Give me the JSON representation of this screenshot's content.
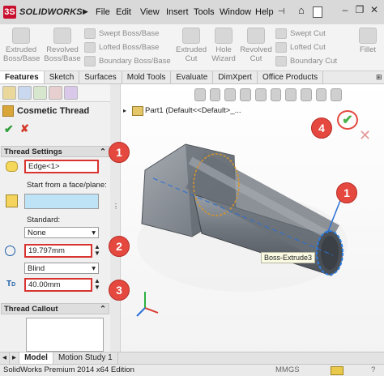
{
  "app": {
    "logo_text": "SOLIDWORKS",
    "menu": [
      "File",
      "Edit",
      "View",
      "Insert",
      "Tools",
      "Window",
      "Help"
    ]
  },
  "ribbon": {
    "buttons": [
      {
        "label": "Extruded\nBoss/Base",
        "icon": "extruded-boss-icon"
      },
      {
        "label": "Revolved\nBoss/Base",
        "icon": "revolved-boss-icon"
      },
      {
        "label": "Extruded\nCut",
        "icon": "extruded-cut-icon"
      },
      {
        "label": "Hole\nWizard",
        "icon": "hole-wizard-icon"
      },
      {
        "label": "Revolved\nCut",
        "icon": "revolved-cut-icon"
      },
      {
        "label": "Fillet",
        "icon": "fillet-icon"
      }
    ],
    "small_left": [
      "Swept Boss/Base",
      "Lofted Boss/Base",
      "Boundary Boss/Base"
    ],
    "small_right": [
      "Swept Cut",
      "Lofted Cut",
      "Boundary Cut"
    ]
  },
  "tabs": [
    "Features",
    "Sketch",
    "Surfaces",
    "Mold Tools",
    "Evaluate",
    "DimXpert",
    "Office Products"
  ],
  "property_manager": {
    "title": "Cosmetic Thread",
    "thread_settings": {
      "header": "Thread Settings",
      "edge": "Edge<1>",
      "start_label": "Start from a face/plane:",
      "standard_label": "Standard:",
      "standard_value": "None",
      "diameter": "19.797mm",
      "end_condition": "Blind",
      "depth": "40.00mm"
    },
    "thread_callout": {
      "header": "Thread Callout"
    }
  },
  "graphics": {
    "tree_root": "Part1  (Default<<Default>_...",
    "tooltip": "Boss-Extrude3"
  },
  "callouts": [
    "1",
    "2",
    "3",
    "4",
    "1"
  ],
  "bottom_tabs": [
    "Model",
    "Motion Study 1"
  ],
  "status": {
    "left": "SolidWorks Premium 2014 x64 Edition",
    "units": "MMGS"
  },
  "colors": {
    "callout_red": "#e4483f",
    "ok_green": "#2e9d3a",
    "cancel_red": "#d23a2a",
    "part_gray": "#7a7f86",
    "edge_blue": "#1f6fe0"
  }
}
